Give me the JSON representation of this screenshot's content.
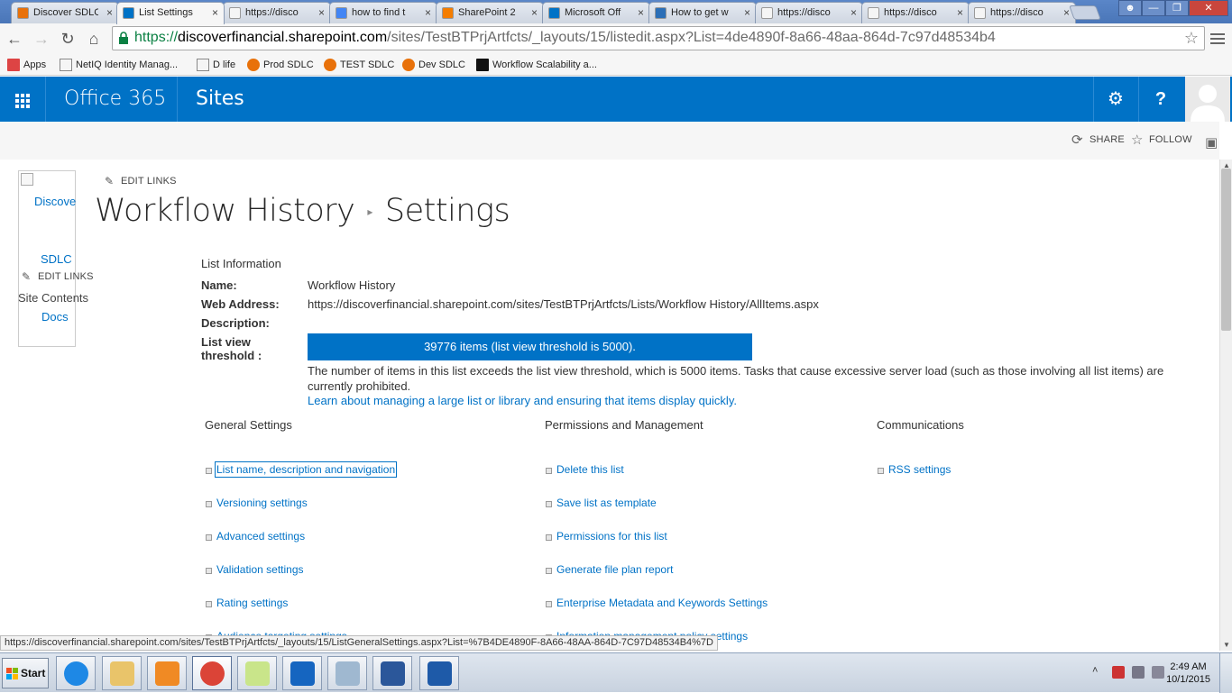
{
  "browser": {
    "tabs": [
      {
        "title": "Discover SDLC",
        "fav": "#e8710a",
        "active": false
      },
      {
        "title": "List Settings",
        "fav": "#0072c6",
        "active": true
      },
      {
        "title": "https://disco",
        "fav": "#f5f5f5",
        "active": false
      },
      {
        "title": "how to find t",
        "fav": "#4285f4",
        "active": false
      },
      {
        "title": "SharePoint 2",
        "fav": "#f57d00",
        "active": false
      },
      {
        "title": "Microsoft Off",
        "fav": "#0072c6",
        "active": false
      },
      {
        "title": "How to get w",
        "fav": "#2c6fb7",
        "active": false
      },
      {
        "title": "https://disco",
        "fav": "#f5f5f5",
        "active": false
      },
      {
        "title": "https://disco",
        "fav": "#f5f5f5",
        "active": false
      },
      {
        "title": "https://disco",
        "fav": "#f5f5f5",
        "active": false
      }
    ],
    "url": {
      "protocol": "https://",
      "host": "discoverfinancial.sharepoint.com",
      "path": "/sites/TestBTPrjArtfcts/_layouts/15/listedit.aspx?List=4de4890f-8a66-48aa-864d-7c97d48534b4"
    },
    "bookmarks": [
      {
        "label": "Apps",
        "color": "#d44"
      },
      {
        "label": "NetIQ Identity Manag...",
        "color": "#f5f5f5"
      },
      {
        "label": "D life",
        "color": "#f5f5f5"
      },
      {
        "label": "Prod SDLC",
        "color": "#e8710a"
      },
      {
        "label": "TEST SDLC",
        "color": "#e8710a"
      },
      {
        "label": "Dev SDLC",
        "color": "#e8710a"
      },
      {
        "label": "Workflow Scalability a...",
        "color": "#111"
      }
    ]
  },
  "suite": {
    "brand": "Office 365",
    "app": "Sites",
    "accent": "#0072c6"
  },
  "ribbon": {
    "share": "SHARE",
    "follow": "FOLLOW"
  },
  "leftnav": {
    "logo_alt": "Discove",
    "items": [
      "SDLC",
      "Site Contents",
      "Docs"
    ],
    "edit_links": "EDIT LINKS"
  },
  "top_edit_links": "EDIT LINKS",
  "title": {
    "list": "Workflow History",
    "page": "Settings"
  },
  "info": {
    "section": "List Information",
    "name_label": "Name:",
    "name": "Workflow History",
    "web_label": "Web Address:",
    "web": "https://discoverfinancial.sharepoint.com/sites/TestBTPrjArtfcts/Lists/Workflow History/AllItems.aspx",
    "desc_label": "Description:",
    "threshold_label_1": "List view",
    "threshold_label_2": "threshold :",
    "threshold_bar": "39776 items (list view threshold is 5000).",
    "threshold_msg": "The number of items in this list exceeds the list view threshold, which is 5000 items. Tasks that cause excessive server load (such as those involving all list items) are currently prohibited.",
    "learn_link": "Learn about managing a large list or library and ensuring that items display quickly."
  },
  "settings": {
    "general": {
      "heading": "General Settings",
      "links": [
        "List name, description and navigation",
        "Versioning settings",
        "Advanced settings",
        "Validation settings",
        "Rating settings",
        "Audience targeting settings"
      ]
    },
    "permissions": {
      "heading": "Permissions and Management",
      "links": [
        "Delete this list",
        "Save list as template",
        "Permissions for this list",
        "Generate file plan report",
        "Enterprise Metadata and Keywords Settings",
        "Information management policy settings"
      ]
    },
    "communications": {
      "heading": "Communications",
      "links": [
        "RSS settings"
      ]
    }
  },
  "status_url": "https://discoverfinancial.sharepoint.com/sites/TestBTPrjArtfcts/_layouts/15/ListGeneralSettings.aspx?List=%7B4DE4890F-8A66-48AA-864D-7C97D48534B4%7D",
  "taskbar": {
    "start": "Start",
    "apps": [
      {
        "name": "internet-explorer",
        "color": "#1e88e5"
      },
      {
        "name": "file-explorer",
        "color": "#e9c46a"
      },
      {
        "name": "media-player",
        "color": "#f08a24"
      },
      {
        "name": "chrome",
        "color": "#db4437"
      },
      {
        "name": "sticky-notes",
        "color": "#c9e58a"
      },
      {
        "name": "outlook",
        "color": "#1565c0"
      },
      {
        "name": "notepad",
        "color": "#9fb8d0"
      },
      {
        "name": "word",
        "color": "#2b579a"
      },
      {
        "name": "tools",
        "color": "#1e5aa8"
      }
    ],
    "time": "2:49 AM",
    "date": "10/1/2015"
  }
}
